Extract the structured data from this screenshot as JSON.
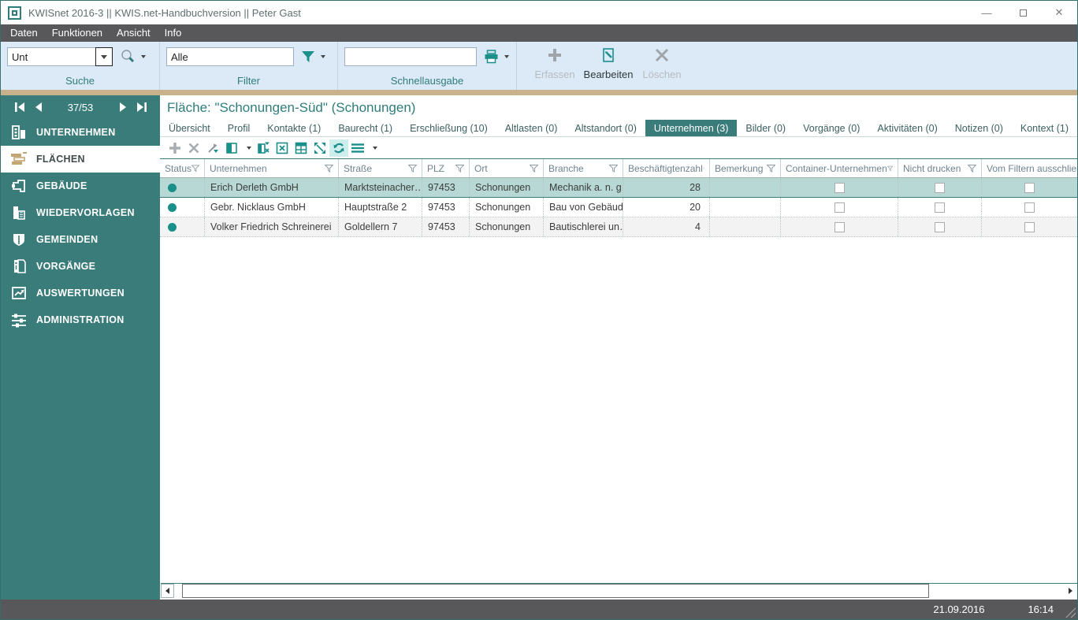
{
  "window": {
    "title": "KWISnet 2016-3 || KWIS.net-Handbuchversion || Peter Gast"
  },
  "menubar": {
    "items": [
      "Daten",
      "Funktionen",
      "Ansicht",
      "Info"
    ]
  },
  "toolbar": {
    "suche": {
      "value": "Unt",
      "label": "Suche"
    },
    "filter": {
      "value": "Alle",
      "label": "Filter"
    },
    "schnellausgabe": {
      "value": "",
      "label": "Schnellausgabe"
    },
    "buttons": [
      {
        "label": "Erfassen",
        "icon": "add-icon",
        "enabled": false
      },
      {
        "label": "Bearbeiten",
        "icon": "edit-icon",
        "enabled": true
      },
      {
        "label": "Löschen",
        "icon": "delete-icon",
        "enabled": false
      }
    ]
  },
  "sidebar": {
    "counter": "37/53",
    "items": [
      {
        "label": "UNTERNEHMEN",
        "icon": "companies-icon",
        "selected": false
      },
      {
        "label": "FLÄCHEN",
        "icon": "areas-icon",
        "selected": true
      },
      {
        "label": "GEBÄUDE",
        "icon": "building-icon",
        "selected": false
      },
      {
        "label": "WIEDERVORLAGEN",
        "icon": "resubmission-icon",
        "selected": false
      },
      {
        "label": "GEMEINDEN",
        "icon": "shield-icon",
        "selected": false
      },
      {
        "label": "VORGÄNGE",
        "icon": "binder-icon",
        "selected": false
      },
      {
        "label": "AUSWERTUNGEN",
        "icon": "chart-icon",
        "selected": false
      },
      {
        "label": "ADMINISTRATION",
        "icon": "sliders-icon",
        "selected": false
      }
    ]
  },
  "main": {
    "page_title": "Fläche: \"Schonungen-Süd\" (Schonungen)",
    "tabs": [
      {
        "label": "Übersicht",
        "selected": false
      },
      {
        "label": "Profil",
        "selected": false
      },
      {
        "label": "Kontakte (1)",
        "selected": false
      },
      {
        "label": "Baurecht (1)",
        "selected": false
      },
      {
        "label": "Erschließung (10)",
        "selected": false
      },
      {
        "label": "Altlasten (0)",
        "selected": false
      },
      {
        "label": "Altstandort (0)",
        "selected": false
      },
      {
        "label": "Unternehmen (3)",
        "selected": true
      },
      {
        "label": "Bilder (0)",
        "selected": false
      },
      {
        "label": "Vorgänge (0)",
        "selected": false
      },
      {
        "label": "Aktivitäten (0)",
        "selected": false
      },
      {
        "label": "Notizen (0)",
        "selected": false
      },
      {
        "label": "Kontext (1)",
        "selected": false
      }
    ],
    "grid_toolbar_icons": [
      "add-icon",
      "delete-icon",
      "clear-sort-icon",
      "choose-columns-icon",
      "remove-column-icon",
      "export-excel-icon",
      "table-layout-icon",
      "fit-columns-icon",
      "refresh-icon",
      "menu-icon"
    ]
  },
  "table": {
    "columns": [
      "Status",
      "Unternehmen",
      "Straße",
      "PLZ",
      "Ort",
      "Branche",
      "Beschäftigtenzahl",
      "Bemerkung",
      "Container-Unternehmen",
      "Nicht drucken",
      "Vom Filtern ausschließen"
    ],
    "rows": [
      {
        "unternehmen": "Erich Derleth GmbH",
        "strasse": "Marktsteinacher…",
        "plz": "97453",
        "ort": "Schonungen",
        "branche": "Mechanik a. n. g.",
        "beschaeftigte": "28"
      },
      {
        "unternehmen": "Gebr. Nicklaus GmbH",
        "strasse": "Hauptstraße 2",
        "plz": "97453",
        "ort": "Schonungen",
        "branche": "Bau von Gebäud…",
        "beschaeftigte": "20"
      },
      {
        "unternehmen": "Volker Friedrich Schreinerei",
        "strasse": "Goldellern 7",
        "plz": "97453",
        "ort": "Schonungen",
        "branche": "Bautischlerei un…",
        "beschaeftigte": "4"
      }
    ]
  },
  "statusbar": {
    "date": "21.09.2016",
    "time": "16:14"
  },
  "colors": {
    "accent_teal": "#3A7C7A",
    "icon_teal": "#1B8F8A",
    "toolbar_bg": "#DCE9F6",
    "tan_strip": "#C9B28B",
    "menubar_bg": "#58585A",
    "selected_row_bg": "#B7D8D5",
    "alt_row_bg": "#F3F3F3"
  }
}
